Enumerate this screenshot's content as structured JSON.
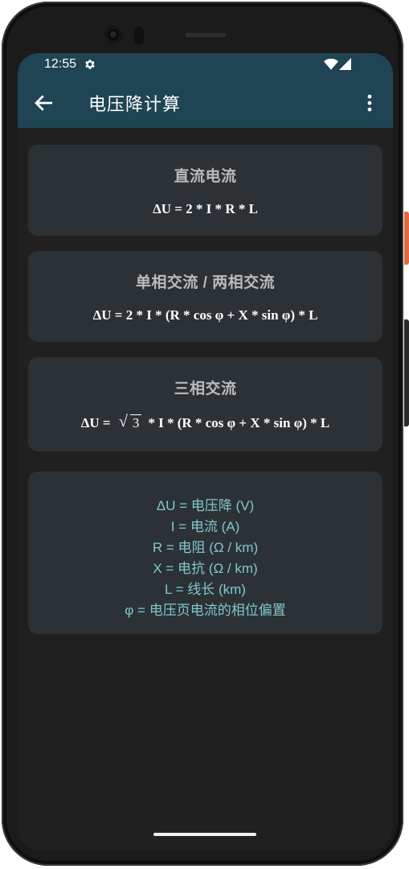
{
  "status_bar": {
    "time": "12:55",
    "icons": [
      "settings-icon",
      "wifi-icon",
      "signal-icon"
    ]
  },
  "app_bar": {
    "title": "电压降计算",
    "back_icon": "arrow-left-icon",
    "menu_icon": "more-vertical-icon"
  },
  "cards": [
    {
      "title": "直流电流",
      "formula": "ΔU = 2 * I * R * L"
    },
    {
      "title": "单相交流 / 两相交流",
      "formula": "ΔU = 2 * I * (R * cos φ + X * sin φ) * L"
    },
    {
      "title": "三相交流",
      "formula_prefix": "ΔU = ",
      "formula_sqrt": "3",
      "formula_suffix": "* I * (R * cos φ + X * sin φ) * L"
    }
  ],
  "legend": [
    "ΔU = 电压降 (V)",
    "I = 电流 (A)",
    "R = 电阻 (Ω / km)",
    "X = 电抗 (Ω / km)",
    "L = 线长 (km)",
    "φ = 电压页电流的相位偏置"
  ],
  "colors": {
    "app_bar": "#1f4453",
    "background": "#202020",
    "card": "#2c3135",
    "card_title": "#b9bcbe",
    "legend_text": "#7fc9cc",
    "phone_accent_button": "#e06b44"
  }
}
